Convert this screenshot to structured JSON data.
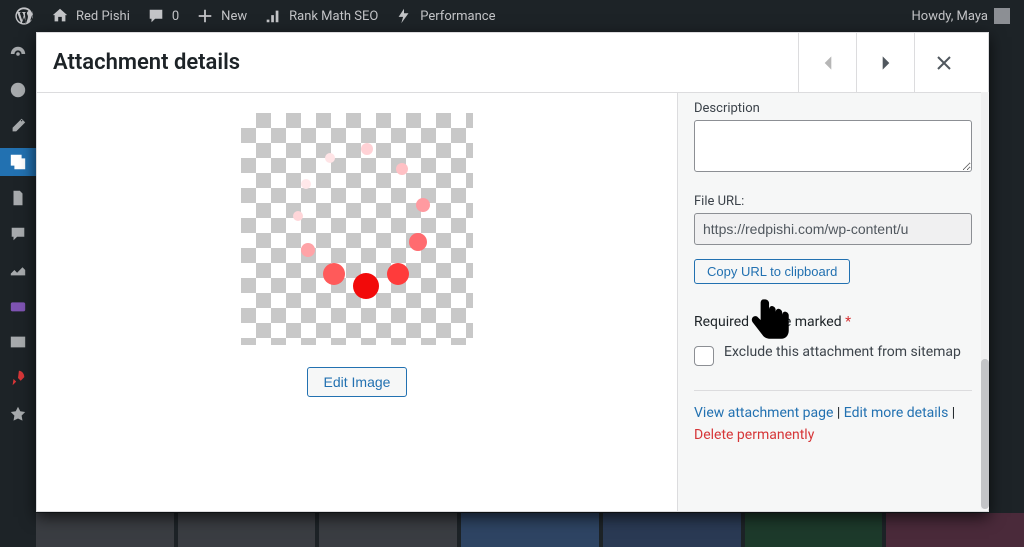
{
  "adminbar": {
    "site_name": "Red Pishi",
    "comments_count": "0",
    "new_label": "New",
    "rankmath_label": "Rank Math SEO",
    "performance_label": "Performance",
    "howdy": "Howdy, Maya"
  },
  "modal": {
    "title": "Attachment details"
  },
  "details": {
    "description_label": "Description",
    "description_value": "",
    "file_url_label": "File URL:",
    "file_url_value": "https://redpishi.com/wp-content/u",
    "copy_btn": "Copy URL to clipboard",
    "required_prefix": "Required",
    "required_suffix": "e marked",
    "exclude_label": "Exclude this attachment from sitemap",
    "view_link": "View attachment page",
    "edit_more_link": "Edit more details",
    "delete_link": "Delete permanently"
  },
  "preview": {
    "edit_image_label": "Edit Image"
  }
}
